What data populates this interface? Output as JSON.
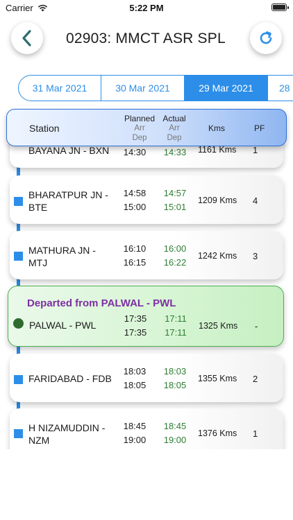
{
  "status_bar": {
    "carrier": "Carrier",
    "time": "5:22 PM"
  },
  "header": {
    "title": "02903: MMCT ASR SPL"
  },
  "dates": [
    "31 Mar 2021",
    "30 Mar 2021",
    "29 Mar 2021",
    "28"
  ],
  "active_date_index": 2,
  "columns": {
    "station": "Station",
    "planned": "Planned",
    "actual": "Actual",
    "arr": "Arr",
    "dep": "Dep",
    "kms": "Kms",
    "pf": "PF"
  },
  "partial_row": {
    "name": "BAYANA JN - BXN",
    "planned_dep": "14:30",
    "actual_dep": "14:33",
    "kms": "1161 Kms",
    "pf": "1"
  },
  "stations": [
    {
      "name_line1": "BHARATPUR JN -",
      "name_line2": "BTE",
      "planned_arr": "14:58",
      "planned_dep": "15:00",
      "actual_arr": "14:57",
      "actual_dep": "15:01",
      "kms": "1209 Kms",
      "pf": "4"
    },
    {
      "name_line1": "MATHURA JN -",
      "name_line2": "MTJ",
      "planned_arr": "16:10",
      "planned_dep": "16:15",
      "actual_arr": "16:00",
      "actual_dep": "16:22",
      "kms": "1242 Kms",
      "pf": "3"
    },
    {
      "name_line1": "PALWAL - PWL",
      "name_line2": "",
      "planned_arr": "17:35",
      "planned_dep": "17:35",
      "actual_arr": "17:11",
      "actual_dep": "17:11",
      "kms": "1325 Kms",
      "pf": "-",
      "status": "Departed from PALWAL - PWL"
    },
    {
      "name_line1": "FARIDABAD - FDB",
      "name_line2": "",
      "planned_arr": "18:03",
      "planned_dep": "18:05",
      "actual_arr": "18:03",
      "actual_dep": "18:05",
      "kms": "1355 Kms",
      "pf": "2"
    },
    {
      "name_line1": "H NIZAMUDDIN -",
      "name_line2": "NZM",
      "planned_arr": "18:45",
      "planned_dep": "19:00",
      "actual_arr": "18:45",
      "actual_dep": "19:00",
      "kms": "1376 Kms",
      "pf": "1"
    }
  ],
  "colors": {
    "accent": "#2c8ee8",
    "actual_time": "#2e7d32",
    "departed_text": "#7d2fa3",
    "current_dot": "#2f6b2f"
  }
}
